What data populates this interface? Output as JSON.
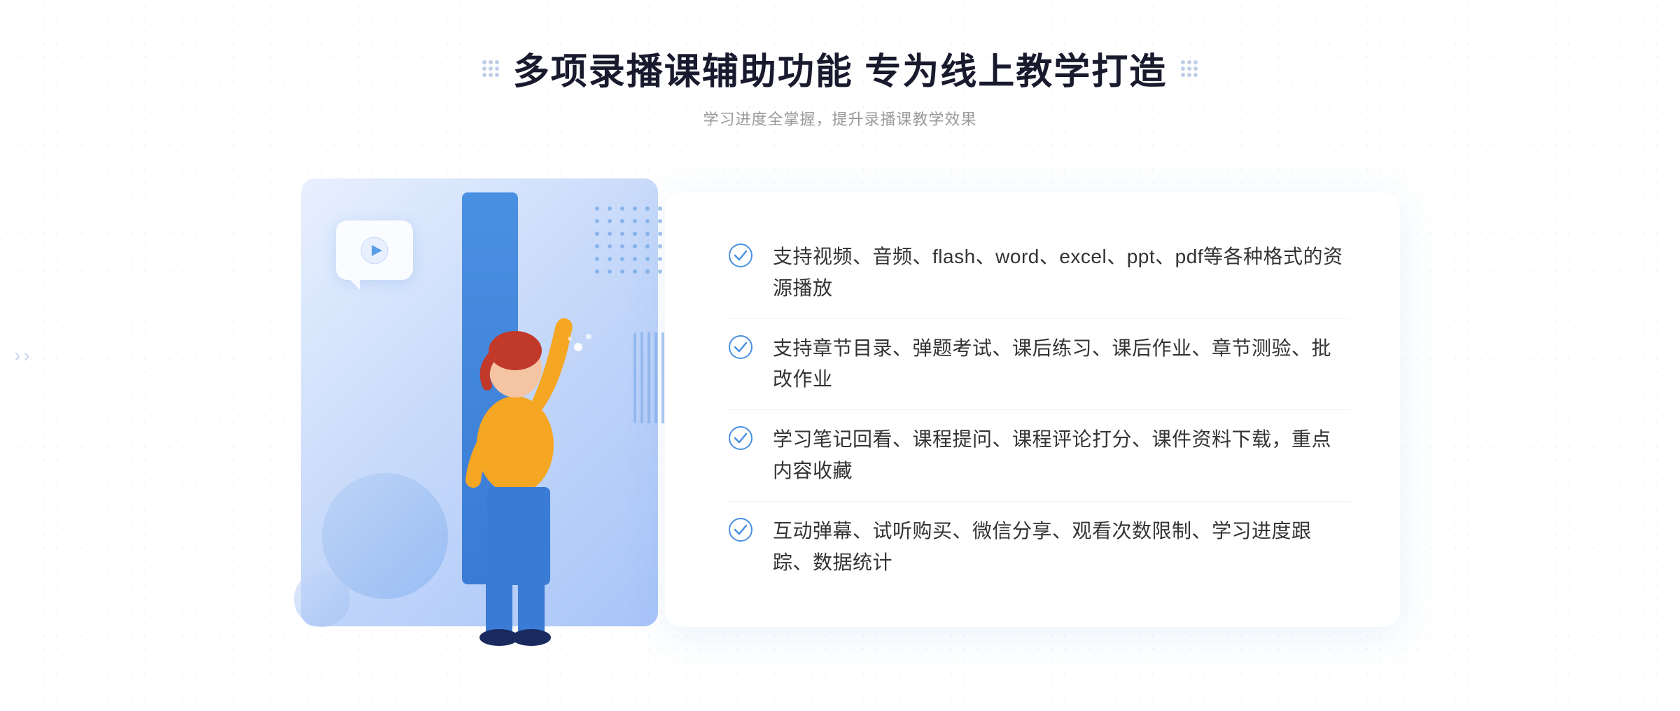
{
  "header": {
    "title": "多项录播课辅助功能 专为线上教学打造",
    "subtitle": "学习进度全掌握，提升录播课教学效果"
  },
  "features": [
    {
      "id": 1,
      "text": "支持视频、音频、flash、word、excel、ppt、pdf等各种格式的资源播放"
    },
    {
      "id": 2,
      "text": "支持章节目录、弹题考试、课后练习、课后作业、章节测验、批改作业"
    },
    {
      "id": 3,
      "text": "学习笔记回看、课程提问、课程评论打分、课件资料下载，重点内容收藏"
    },
    {
      "id": 4,
      "text": "互动弹幕、试听购买、微信分享、观看次数限制、学习进度跟踪、数据统计"
    }
  ],
  "colors": {
    "primary_blue": "#4a90e2",
    "dark_blue": "#1a3a6b",
    "text_dark": "#333333",
    "text_light": "#999999",
    "bg_white": "#ffffff"
  }
}
